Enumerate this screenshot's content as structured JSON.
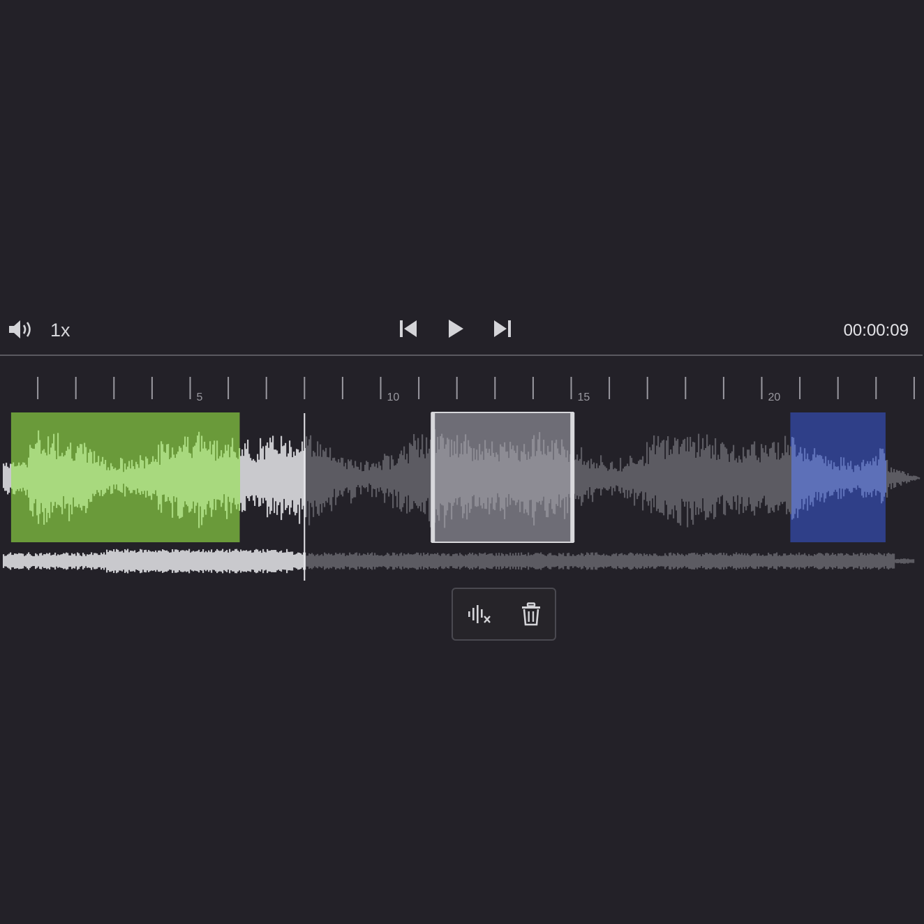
{
  "player": {
    "volume_icon": "speaker-volume-icon",
    "speed_label": "1x",
    "prev_icon": "skip-previous-icon",
    "play_icon": "play-icon",
    "next_icon": "skip-next-icon",
    "time_display": "00:00:09"
  },
  "ruler": {
    "labels": [
      "5",
      "10",
      "15",
      "20"
    ],
    "major_seconds": [
      0,
      5,
      10,
      15,
      20
    ]
  },
  "playhead": {
    "seconds": 8.0
  },
  "regions": [
    {
      "name": "region-green",
      "start": 0.3,
      "end": 6.3,
      "color": "#6a9a3a",
      "wave_color": "#a8d97e"
    },
    {
      "name": "region-selected",
      "start": 11.35,
      "end": 15.05,
      "color": "#77767e",
      "wave_color": "#8d8c94",
      "selected": true
    },
    {
      "name": "region-blue",
      "start": 20.75,
      "end": 23.25,
      "color": "#2f3f88",
      "wave_color": "#5d70b8"
    }
  ],
  "actions": {
    "remove_silence_icon": "waveform-x-icon",
    "delete_icon": "trash-icon"
  },
  "colors": {
    "background": "#232128",
    "wave_played": "#c9c9cd",
    "wave_unplayed": "#5c5b62",
    "tick": "#9a99a0"
  }
}
